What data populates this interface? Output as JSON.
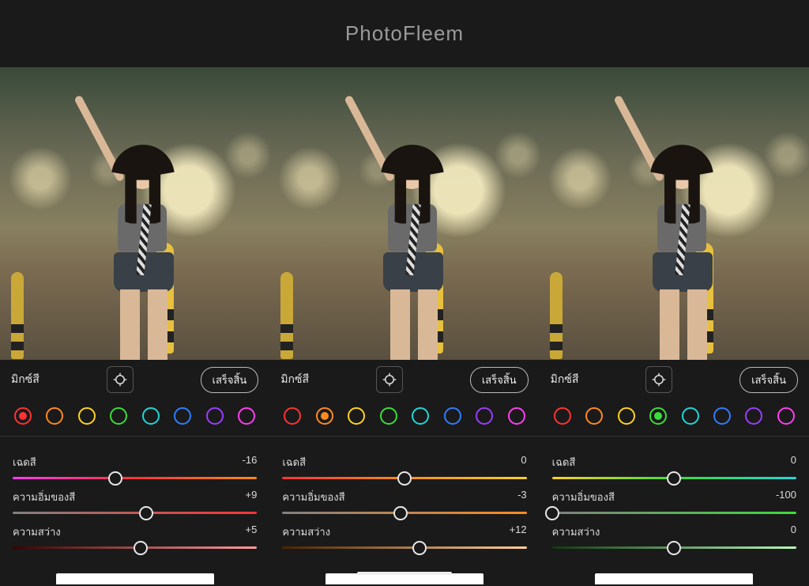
{
  "header": {
    "title": "PhotoFleem"
  },
  "labels": {
    "mix": "มิกซ์สี",
    "done": "เสร็จสิ้น",
    "hue": "เฉดสี",
    "saturation": "ความอิ่มของสี",
    "luminance": "ความสว่าง"
  },
  "swatch_colors": [
    "#ff3333",
    "#ff8a1f",
    "#ffd21f",
    "#3bdc3b",
    "#1fd7d7",
    "#2f7dff",
    "#9a3dff",
    "#ff3df0"
  ],
  "panels": [
    {
      "active_swatch": 0,
      "sliders": {
        "hue": {
          "value": -16,
          "grad": [
            "#ff3df0",
            "#ff3333",
            "#ff8a1f"
          ]
        },
        "saturation": {
          "value": 9,
          "grad": [
            "#808080",
            "#ff3333"
          ]
        },
        "luminance": {
          "value": 5,
          "grad": [
            "#3a0000",
            "#ff9a9a"
          ]
        }
      }
    },
    {
      "active_swatch": 1,
      "sliders": {
        "hue": {
          "value": 0,
          "grad": [
            "#ff3333",
            "#ff8a1f",
            "#ffd21f"
          ]
        },
        "saturation": {
          "value": -3,
          "grad": [
            "#808080",
            "#ff8a1f"
          ]
        },
        "luminance": {
          "value": 12,
          "grad": [
            "#4a2300",
            "#ffcf99"
          ]
        }
      }
    },
    {
      "active_swatch": 3,
      "sliders": {
        "hue": {
          "value": 0,
          "grad": [
            "#ffd21f",
            "#3bdc3b",
            "#1fd7d7"
          ]
        },
        "saturation": {
          "value": -100,
          "grad": [
            "#808080",
            "#3bdc3b"
          ]
        },
        "luminance": {
          "value": 0,
          "grad": [
            "#0f3a0f",
            "#b8f5b8"
          ]
        }
      }
    }
  ]
}
